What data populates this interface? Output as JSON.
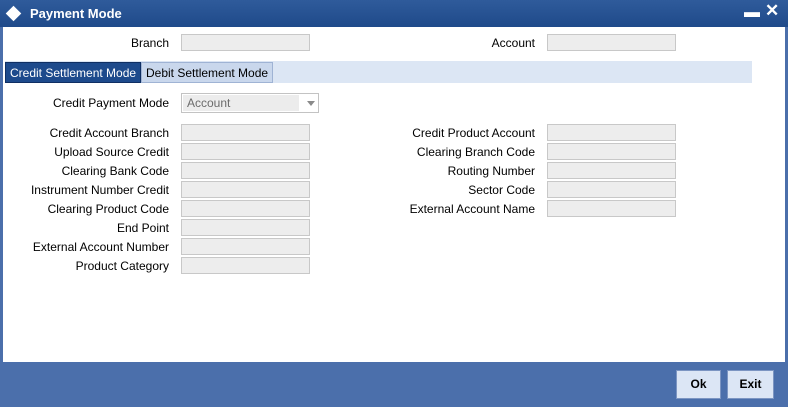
{
  "window": {
    "title": "Payment Mode"
  },
  "header": {
    "branch_label": "Branch",
    "account_label": "Account"
  },
  "tabs": [
    {
      "label": "Credit Settlement Mode",
      "active": true
    },
    {
      "label": "Debit Settlement Mode",
      "active": false
    }
  ],
  "credit_payment_mode": {
    "label": "Credit Payment Mode",
    "value": "Account"
  },
  "left_fields": [
    {
      "label": "Credit Account Branch"
    },
    {
      "label": "Upload Source Credit"
    },
    {
      "label": "Clearing Bank Code"
    },
    {
      "label": "Instrument Number Credit"
    },
    {
      "label": "Clearing Product Code"
    },
    {
      "label": "End Point"
    },
    {
      "label": "External Account Number"
    },
    {
      "label": "Product Category"
    }
  ],
  "right_fields": [
    {
      "label": "Credit Product Account"
    },
    {
      "label": "Clearing Branch Code"
    },
    {
      "label": "Routing Number"
    },
    {
      "label": "Sector Code"
    },
    {
      "label": "External Account Name"
    }
  ],
  "buttons": {
    "ok": "Ok",
    "exit": "Exit"
  },
  "colors": {
    "titlebar": "#1f4a8a",
    "frame": "#4b6fab",
    "tab_active": "#1d4a8c",
    "field_bg": "#ededed"
  }
}
